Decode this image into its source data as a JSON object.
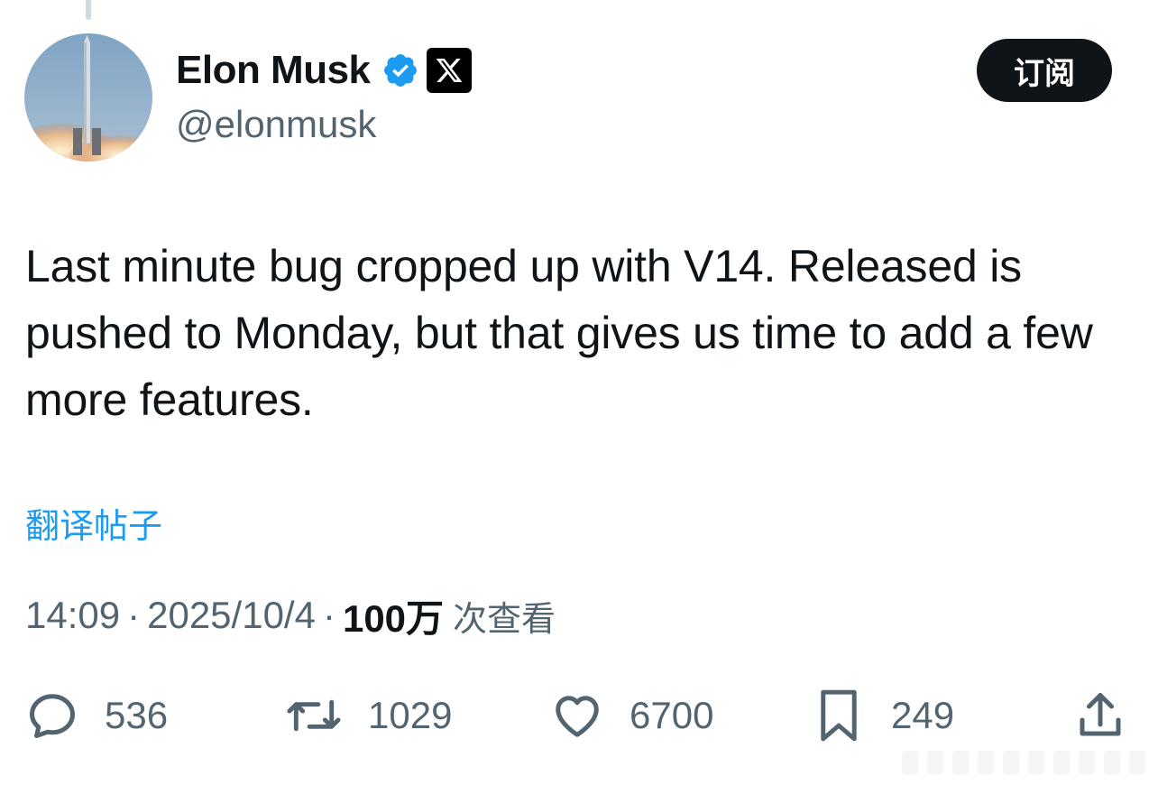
{
  "user": {
    "display_name": "Elon Musk",
    "handle": "@elonmusk",
    "verified_color": "#1d9bf0"
  },
  "header": {
    "subscribe_label": "订阅"
  },
  "tweet": {
    "text": "Last minute bug cropped up with V14. Released is pushed to Monday, but that gives us time to add a few more features.",
    "translate_label": "翻译帖子",
    "time": "14:09",
    "date": "2025/10/4",
    "separator": "·",
    "views_count": "100万",
    "views_label": "次查看"
  },
  "actions": {
    "replies": "536",
    "reposts": "1029",
    "likes": "6700",
    "bookmarks": "249"
  },
  "icons": {
    "reply": "reply-icon",
    "repost": "repost-icon",
    "like": "heart-icon",
    "bookmark": "bookmark-icon",
    "share": "share-icon"
  }
}
